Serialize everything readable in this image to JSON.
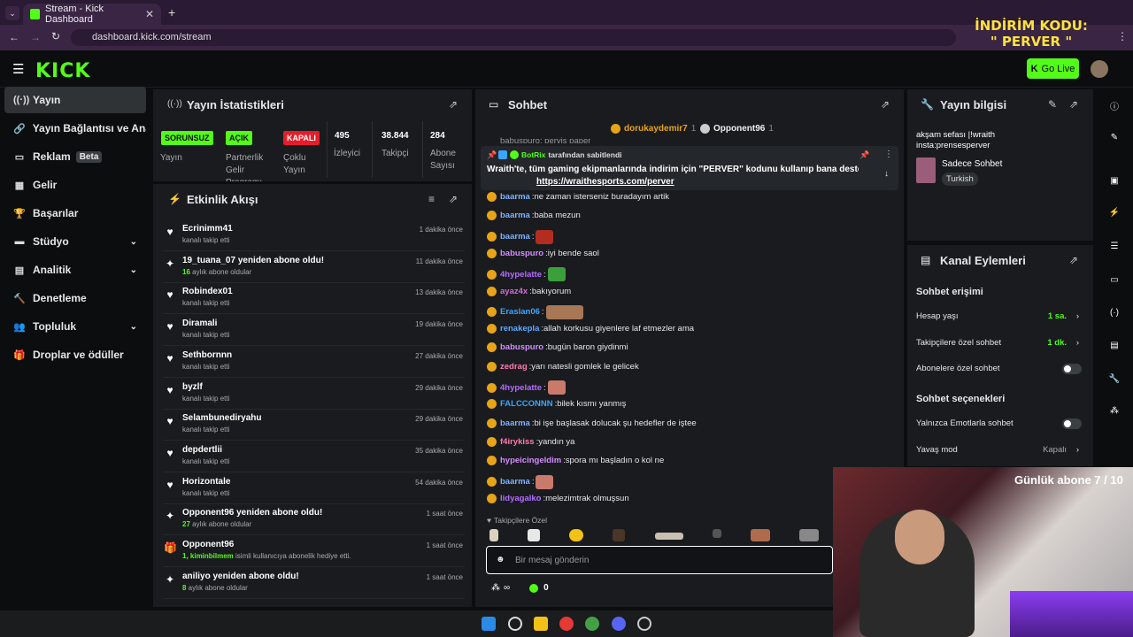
{
  "browser": {
    "tab_title": "Stream - Kick Dashboard",
    "url": "dashboard.kick.com/stream",
    "overlay_promo": "İNDİRİM KODU: \" PERVER \""
  },
  "header": {
    "logo": "KICK",
    "go_live": "Go Live"
  },
  "sidebar": {
    "items": [
      {
        "label": "Yayın",
        "icon": "stream-icon"
      },
      {
        "label": "Yayın Bağlantısı ve Anahtarı",
        "icon": "link-icon"
      },
      {
        "label": "Reklam",
        "icon": "ad-icon",
        "badge": "Beta"
      },
      {
        "label": "Gelir",
        "icon": "revenue-icon"
      },
      {
        "label": "Başarılar",
        "icon": "trophy-icon"
      },
      {
        "label": "Stüdyo",
        "icon": "studio-icon"
      },
      {
        "label": "Analitik",
        "icon": "analytics-icon"
      },
      {
        "label": "Denetleme",
        "icon": "moderation-icon"
      },
      {
        "label": "Topluluk",
        "icon": "community-icon"
      },
      {
        "label": "Droplar ve ödüller",
        "icon": "drops-icon"
      }
    ]
  },
  "stats": {
    "title": "Yayın İstatistikleri",
    "items": [
      {
        "badge": "SORUNSUZ",
        "label": "Yayın"
      },
      {
        "badge": "AÇIK",
        "label": "Partnerlik Gelir Programı"
      },
      {
        "badge": "KAPALI",
        "label": "Çoklu Yayın"
      },
      {
        "value": "495",
        "label": "İzleyici"
      },
      {
        "value": "38.844",
        "label": "Takipçi"
      },
      {
        "value": "284",
        "label": "Abone Sayısı"
      }
    ]
  },
  "activity": {
    "title": "Etkinlik Akışı",
    "events": [
      {
        "name": "Ecrinimm41",
        "sub": "kanalı takip etti",
        "time": "1 dakika önce",
        "icon": "heart-icon"
      },
      {
        "name": "19_tuana_07 yeniden abone oldu!",
        "sub_strong": "16",
        "sub": " aylık abone oldular",
        "time": "11 dakika önce",
        "icon": "sparkle-icon"
      },
      {
        "name": "Robindex01",
        "sub": "kanalı takip etti",
        "time": "13 dakika önce",
        "icon": "heart-icon"
      },
      {
        "name": "Diramali",
        "sub": "kanalı takip etti",
        "time": "19 dakika önce",
        "icon": "heart-icon"
      },
      {
        "name": "Sethbornnn",
        "sub": "kanalı takip etti",
        "time": "27 dakika önce",
        "icon": "heart-icon"
      },
      {
        "name": "byzlf",
        "sub": "kanalı takip etti",
        "time": "29 dakika önce",
        "icon": "heart-icon"
      },
      {
        "name": "Selambunediryahu",
        "sub": "kanalı takip etti",
        "time": "29 dakika önce",
        "icon": "heart-icon"
      },
      {
        "name": "depdertlii",
        "sub": "kanalı takip etti",
        "time": "35 dakika önce",
        "icon": "heart-icon"
      },
      {
        "name": "Horizontale",
        "sub": "kanalı takip etti",
        "time": "54 dakika önce",
        "icon": "heart-icon"
      },
      {
        "name": "Opponent96 yeniden abone oldu!",
        "sub_strong": "27",
        "sub": " aylık abone oldular",
        "time": "1 saat önce",
        "icon": "sparkle-icon"
      },
      {
        "name": "Opponent96",
        "sub_strong": "1, kiminbilmem",
        "sub": " isimli kullanıcıya abonelik hediye etti.",
        "time": "1 saat önce",
        "icon": "gift-icon"
      },
      {
        "name": "aniliyo yeniden abone oldu!",
        "sub_strong": "8",
        "sub": " aylık abone oldular",
        "time": "1 saat önce",
        "icon": "sparkle-icon"
      }
    ]
  },
  "chat": {
    "title": "Sohbet",
    "top_gifters": [
      {
        "name": "dorukaydemir7",
        "count": "1"
      },
      {
        "name": "Opponent96",
        "count": "1"
      }
    ],
    "cut_message": "babuspuro: pervis paper",
    "pinned": {
      "by": "BotRix",
      "by_suffix": "tarafından sabitlendi",
      "text": "Wraith'te, tüm gaming ekipmanlarında indirim için \"PERVER\" kodunu kullanıp bana destek olabilirsiniz!",
      "link": "https://wraithesports.com/perver"
    },
    "messages": [
      {
        "user": "baarma",
        "text": "ne zaman isterseniz buradayım artik",
        "color": "#7fb3ff"
      },
      {
        "user": "baarma",
        "text": "baba mezun",
        "color": "#7fb3ff"
      },
      {
        "user": "baarma",
        "text": "",
        "color": "#7fb3ff",
        "emote": true
      },
      {
        "user": "babuspuro",
        "text": "iyi bende saol",
        "color": "#d58cff"
      },
      {
        "user": "4hypelatte",
        "text": "",
        "color": "#b56cff",
        "emote": true
      },
      {
        "user": "ayaz4x",
        "text": "bakıyorum",
        "color": "#d66bd6"
      },
      {
        "user": "Eraslan06",
        "text": "",
        "color": "#3aa6ff",
        "emote": true
      },
      {
        "user": "renakepla",
        "text": "allah korkusu giyenlere laf etmezler ama",
        "color": "#5da9ff"
      },
      {
        "user": "babuspuro",
        "text": "bugün baron giydinmi",
        "color": "#d58cff"
      },
      {
        "user": "zedrag",
        "text": "yarı natesli gomlek le gelicek",
        "color": "#ff7ab0"
      },
      {
        "user": "4hypelatte",
        "text": "",
        "color": "#b56cff",
        "emote": true
      },
      {
        "user": "FALCCONNN",
        "text": "bilek kısmı yanmış",
        "color": "#3aa6ff"
      },
      {
        "user": "baarma",
        "text": "bi işe başlasak dolucak şu hedefler de iştee",
        "color": "#7fb3ff"
      },
      {
        "user": "f4irykiss",
        "text": "yandın ya",
        "color": "#ff7ab0"
      },
      {
        "user": "hypeicingeldim",
        "text": "spora mı başladın o kol ne",
        "color": "#d58cff"
      },
      {
        "user": "baarma",
        "text": "",
        "color": "#7fb3ff",
        "emote": true
      },
      {
        "user": "lidyagalko",
        "text": "melezimtrak olmuşsun",
        "color": "#b56cff"
      }
    ],
    "followers_only": "Takipçilere Özel",
    "input_placeholder": "Bir mesaj gönderin",
    "infinity": "∞",
    "points": "0"
  },
  "stream_info": {
    "title": "Yayın bilgisi",
    "stream_title": "akşam sefası |!wraith insta:prensesperver",
    "category": "Sadece Sohbet",
    "language": "Turkish"
  },
  "channel_actions": {
    "title": "Kanal Eylemleri",
    "chat_access": "Sohbet erişimi",
    "account_age_label": "Hesap yaşı",
    "account_age_value": "1 sa.",
    "followers_chat_label": "Takipçilere özel sohbet",
    "followers_chat_value": "1 dk.",
    "subs_chat_label": "Abonelere özel sohbet",
    "chat_options": "Sohbet seçenekleri",
    "emote_only_label": "Yalnızca Emotlarla sohbet",
    "slow_mode_label": "Yavaş mod",
    "slow_mode_value": "Kapalı"
  },
  "overlay": {
    "sub_goal": "Günlük abone 7 / 10"
  }
}
